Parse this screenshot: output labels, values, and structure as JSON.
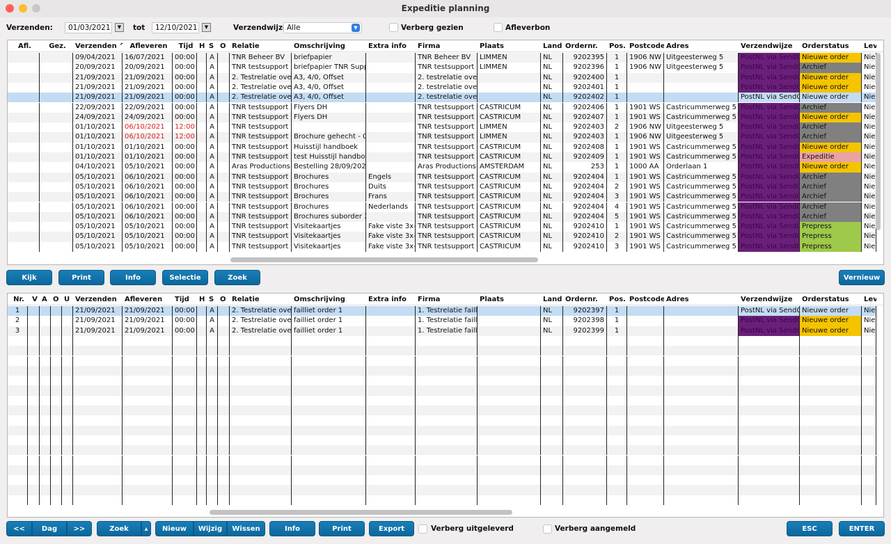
{
  "window": {
    "title": "Expeditie planning"
  },
  "filters": {
    "verzenden_label": "Verzenden:",
    "date_from": "01/03/2021",
    "tot_label": "tot",
    "date_to": "12/10/2021",
    "verzendwijze_label": "Verzendwijze:",
    "verzendwijze_value": "Alle",
    "verberg_gezien": "Verberg gezien",
    "afleverbon": "Afleverbon"
  },
  "colors": {
    "button": "#0b6fa8",
    "selection": "#c4dcf3",
    "verzendwijze": "#6a1f7a",
    "Nieuwe order": "#f5c400",
    "Archief": "#808080",
    "Expeditie": "#eaa3a3",
    "Presspress": "#9ec94a",
    "Prepress": "#9ec94a",
    "late": "#e02020"
  },
  "top_table": {
    "columns": [
      "Afl.",
      "Gez.",
      "Verzenden ^",
      "Afleveren",
      "Tijd",
      "H",
      "S",
      "O",
      "Relatie",
      "Omschrijving",
      "Extra info",
      "Firma",
      "Plaats",
      "Land",
      "Ordernr.",
      "Pos.",
      "Postcode",
      "Adres",
      "Verzendwijze",
      "Orderstatus",
      "Lev"
    ],
    "selected_row": 4,
    "rows": [
      [
        "",
        "",
        "09/04/2021",
        "16/07/2021",
        "00:00",
        "",
        "A",
        "",
        "TNR Beheer BV",
        "briefpapier",
        "",
        "TNR Beheer BV",
        "LIMMEN",
        "NL",
        "9202395",
        "1",
        "1906 NW",
        "Uitgeesterweg 5",
        "PostNL via SendCl",
        "Nieuwe order",
        "Nie"
      ],
      [
        "",
        "",
        "20/09/2021",
        "20/09/2021",
        "00:00",
        "",
        "A",
        "",
        "TNR testsupport l",
        "briefpapier TNR Supp",
        "",
        "TNR testsupport l",
        "LIMMEN",
        "NL",
        "9202396",
        "1",
        "1906 NW",
        "Uitgeesterweg 5",
        "PostNL via SendCl",
        "Archief",
        "Nie"
      ],
      [
        "",
        "",
        "21/09/2021",
        "21/09/2021",
        "00:00",
        "",
        "A",
        "",
        "2. Testrelatie ove",
        "A3, 4/0, Offset",
        "",
        "2. testrelatie over",
        "",
        "NL",
        "9202400",
        "1",
        "",
        "",
        "PostNL via SendCl",
        "Nieuwe order",
        "Nie"
      ],
      [
        "",
        "",
        "21/09/2021",
        "21/09/2021",
        "00:00",
        "",
        "A",
        "",
        "2. Testrelatie ove",
        "A3, 4/0, Offset",
        "",
        "2. testrelatie over",
        "",
        "NL",
        "9202401",
        "1",
        "",
        "",
        "PostNL via SendCl",
        "Nieuwe order",
        "Nie"
      ],
      [
        "",
        "",
        "21/09/2021",
        "21/09/2021",
        "00:00",
        "",
        "A",
        "",
        "2. Testrelatie ove",
        "A3, 4/0, Offset",
        "",
        "2. testrelatie over",
        "",
        "NL",
        "9202402",
        "1",
        "",
        "",
        "PostNL via SendCl",
        "Nieuwe order",
        "Nie"
      ],
      [
        "",
        "",
        "22/09/2021",
        "22/09/2021",
        "00:00",
        "",
        "A",
        "",
        "TNR testsupport l",
        "Flyers DH",
        "",
        "TNR testsupport l",
        "CASTRICUM",
        "NL",
        "9202406",
        "1",
        "1901 WS",
        "Castricummerweg 5",
        "PostNL via SendCl",
        "Archief",
        "Nie"
      ],
      [
        "",
        "",
        "24/09/2021",
        "24/09/2021",
        "00:00",
        "",
        "A",
        "",
        "TNR testsupport l",
        "Flyers DH",
        "",
        "TNR testsupport l",
        "CASTRICUM",
        "NL",
        "9202407",
        "1",
        "1901 WS",
        "Castricummerweg 5",
        "PostNL via SendCl",
        "Nieuwe order",
        "Nie"
      ],
      [
        "",
        "",
        "01/10/2021",
        "06/10/2021",
        "12:00",
        "",
        "A",
        "",
        "TNR testsupport l",
        "",
        "",
        "TNR testsupport l",
        "LIMMEN",
        "NL",
        "9202403",
        "2",
        "1906 NW",
        "Uitgeesterweg 5",
        "PostNL via SendCl",
        "Archief",
        "Nie"
      ],
      [
        "",
        "",
        "01/10/2021",
        "06/10/2021",
        "12:00",
        "",
        "A",
        "",
        "TNR testsupport l",
        "Brochure gehecht - C",
        "",
        "TNR testsupport l",
        "LIMMEN",
        "NL",
        "9202403",
        "1",
        "1906 NW",
        "Uitgeesterweg 5",
        "PostNL via SendCl",
        "Archief",
        "Nie"
      ],
      [
        "",
        "",
        "01/10/2021",
        "01/10/2021",
        "00:00",
        "",
        "A",
        "",
        "TNR testsupport l",
        "Huisstijl handboek",
        "",
        "TNR testsupport l",
        "CASTRICUM",
        "NL",
        "9202408",
        "1",
        "1901 WS",
        "Castricummerweg 5",
        "PostNL via SendCl",
        "Nieuwe order",
        "Nie"
      ],
      [
        "",
        "",
        "01/10/2021",
        "01/10/2021",
        "00:00",
        "",
        "A",
        "",
        "TNR testsupport l",
        "test Huisstijl handboe",
        "",
        "TNR testsupport l",
        "CASTRICUM",
        "NL",
        "9202409",
        "1",
        "1901 WS",
        "Castricummerweg 5",
        "PostNL via SendCl",
        "Expeditie",
        "Nie"
      ],
      [
        "",
        "",
        "04/10/2021",
        "05/10/2021",
        "00:00",
        "",
        "A",
        "",
        "Aras Productions",
        "Bestelling 28/09/202",
        "",
        "Aras Productions",
        "AMSTERDAM",
        "NL",
        "253",
        "1",
        "1000 AA",
        "Orderlaan 1",
        "PostNL via SendCl",
        "Nieuwe order",
        "Nie"
      ],
      [
        "",
        "",
        "05/10/2021",
        "06/10/2021",
        "00:00",
        "",
        "A",
        "",
        "TNR testsupport l",
        "Brochures",
        "Engels",
        "TNR testsupport l",
        "CASTRICUM",
        "NL",
        "9202404",
        "1",
        "1901 WS",
        "Castricummerweg 5",
        "PostNL via SendCl",
        "Archief",
        "Nie"
      ],
      [
        "",
        "",
        "05/10/2021",
        "06/10/2021",
        "00:00",
        "",
        "A",
        "",
        "TNR testsupport l",
        "Brochures",
        "Duits",
        "TNR testsupport l",
        "CASTRICUM",
        "NL",
        "9202404",
        "2",
        "1901 WS",
        "Castricummerweg 5",
        "PostNL via SendCl",
        "Archief",
        "Nie"
      ],
      [
        "",
        "",
        "05/10/2021",
        "06/10/2021",
        "00:00",
        "",
        "A",
        "",
        "TNR testsupport l",
        "Brochures",
        "Frans",
        "TNR testsupport l",
        "CASTRICUM",
        "NL",
        "9202404",
        "3",
        "1901 WS",
        "Castricummerweg 5",
        "PostNL via SendCl",
        "Archief",
        "Nie"
      ],
      [
        "",
        "",
        "05/10/2021",
        "06/10/2021",
        "00:00",
        "",
        "A",
        "",
        "TNR testsupport l",
        "Brochures",
        "Nederlands",
        "TNR testsupport l",
        "CASTRICUM",
        "NL",
        "9202404",
        "4",
        "1901 WS",
        "Castricummerweg 5",
        "PostNL via SendCl",
        "Archief",
        "Nie"
      ],
      [
        "",
        "",
        "05/10/2021",
        "06/10/2021",
        "00:00",
        "",
        "A",
        "",
        "TNR testsupport l",
        "Brochures suborder 2",
        "",
        "TNR testsupport l",
        "CASTRICUM",
        "NL",
        "9202404",
        "5",
        "1901 WS",
        "Castricummerweg 5",
        "PostNL via SendCl",
        "Archief",
        "Nie"
      ],
      [
        "",
        "",
        "05/10/2021",
        "05/10/2021",
        "00:00",
        "",
        "A",
        "",
        "TNR testsupport l",
        "Visitekaartjes",
        "Fake viste 3x-",
        "TNR testsupport l",
        "CASTRICUM",
        "NL",
        "9202410",
        "1",
        "1901 WS",
        "Castricummerweg 5",
        "PostNL via SendCl",
        "Prepress",
        "Nie"
      ],
      [
        "",
        "",
        "05/10/2021",
        "05/10/2021",
        "00:00",
        "",
        "A",
        "",
        "TNR testsupport l",
        "Visitekaartjes",
        "Fake viste 3x-",
        "TNR testsupport l",
        "CASTRICUM",
        "NL",
        "9202410",
        "2",
        "1901 WS",
        "Castricummerweg 5",
        "PostNL via SendCl",
        "Prepress",
        "Nie"
      ],
      [
        "",
        "",
        "05/10/2021",
        "05/10/2021",
        "00:00",
        "",
        "A",
        "",
        "TNR testsupport l",
        "Visitekaartjes",
        "Fake viste 3x-",
        "TNR testsupport l",
        "CASTRICUM",
        "NL",
        "9202410",
        "3",
        "1901 WS",
        "Castricummerweg 5",
        "PostNL via SendCl",
        "Prepress",
        "Nie"
      ]
    ],
    "late_rows": [
      7,
      8
    ]
  },
  "mid_buttons": [
    "Kijk",
    "Print",
    "Info",
    "Selectie",
    "Zoek"
  ],
  "vernieuw": "Vernieuw",
  "bottom_table": {
    "columns": [
      "Nr.",
      "V",
      "A",
      "O",
      "U",
      "Verzenden",
      "Afleveren",
      "Tijd",
      "H",
      "S",
      "O",
      "Relatie",
      "Omschrijving",
      "Extra info",
      "Firma",
      "Plaats",
      "Land",
      "Ordernr.",
      "Pos.",
      "Postcode",
      "Adres",
      "Verzendwijze",
      "Orderstatus",
      "Lev"
    ],
    "selected_row": 0,
    "rows": [
      [
        "1",
        "",
        "",
        "",
        "",
        "21/09/2021",
        "21/09/2021",
        "00:00",
        "",
        "A",
        "",
        "2. Testrelatie ove",
        "failliet order 1",
        "",
        "1. Testrelatie faill",
        "",
        "NL",
        "9202397",
        "1",
        "",
        "",
        "PostNL via SendCl",
        "Nieuwe order",
        "Nie"
      ],
      [
        "2",
        "",
        "",
        "",
        "",
        "21/09/2021",
        "21/09/2021",
        "00:00",
        "",
        "A",
        "",
        "2. Testrelatie ove",
        "failliet order 1",
        "",
        "1. Testrelatie faill",
        "",
        "NL",
        "9202398",
        "1",
        "",
        "",
        "PostNL via SendCl",
        "Nieuwe order",
        "Nie"
      ],
      [
        "3",
        "",
        "",
        "",
        "",
        "21/09/2021",
        "21/09/2021",
        "00:00",
        "",
        "A",
        "",
        "2. Testrelatie ove",
        "failliet order 1",
        "",
        "1. Testrelatie faill",
        "",
        "NL",
        "9202399",
        "1",
        "",
        "",
        "PostNL via SendCl",
        "Nieuwe order",
        "Nie"
      ]
    ]
  },
  "bottom_bar": {
    "prev": "<<",
    "dag": "Dag",
    "next": ">>",
    "zoek": "Zoek",
    "nieuw": "Nieuw",
    "wijzig": "Wijzig",
    "wissen": "Wissen",
    "info": "Info",
    "print": "Print",
    "export": "Export",
    "verberg_uitgeleverd": "Verberg uitgeleverd",
    "verberg_aangemeld": "Verberg aangemeld",
    "esc": "ESC",
    "enter": "ENTER"
  }
}
